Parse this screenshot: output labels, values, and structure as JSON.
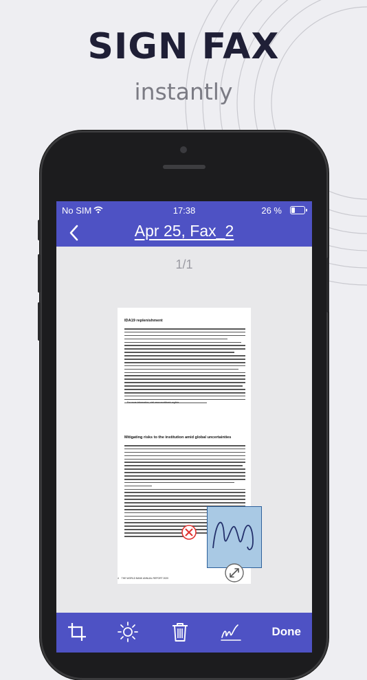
{
  "headline": "SIGN FAX",
  "subline": "instantly",
  "status": {
    "carrier": "No SIM",
    "time": "17:38",
    "battery": "26 %",
    "battery_level": 0.26
  },
  "nav": {
    "title": "Apr 25, Fax_2"
  },
  "viewer": {
    "page_counter": "1/1"
  },
  "document": {
    "heading1": "IDA19 replenishment",
    "note": "For more information, visit www.worldbank.org/ida.",
    "heading2": "Mitigating risks to the institution amid global uncertainties",
    "footer": "THE WORLD BANK ANNUAL REPORT 2020",
    "page_number": "4"
  },
  "toolbar": {
    "crop_icon": "crop-icon",
    "brightness_icon": "brightness-icon",
    "delete_icon": "trash-icon",
    "signature_icon": "signature-icon",
    "done_label": "Done"
  },
  "colors": {
    "accent": "#4e52c4",
    "background": "#eeeef2",
    "signature_box": "#a9c9e4",
    "delete_red": "#e0322f"
  }
}
